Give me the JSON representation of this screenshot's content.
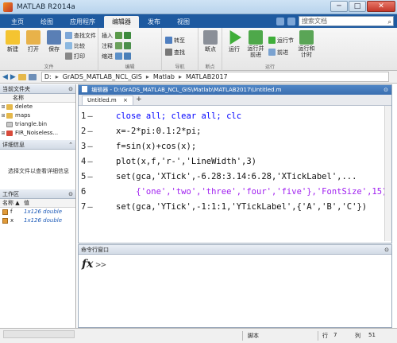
{
  "window": {
    "title": "MATLAB R2014a",
    "minimize": "─",
    "maximize": "□",
    "close": "✕"
  },
  "tabs": [
    "主页",
    "绘图",
    "应用程序",
    "编辑器",
    "发布",
    "视图"
  ],
  "search": {
    "placeholder": "搜索文档",
    "icon": "search-icon"
  },
  "ribbon": {
    "new_label": "新建",
    "open_label": "打开",
    "save_label": "保存",
    "find_files": "查找文件",
    "compare": "比较",
    "print": "打印",
    "insert": "插入",
    "comment": "注释",
    "indent": "缩进",
    "goto": "转至",
    "find": "查找",
    "breakpoints": "断点",
    "run": "运行",
    "run_advance": "运行并\n前进",
    "run_section": "运行节",
    "advance": "前进",
    "run_time": "运行和\n计时",
    "group_file": "文件",
    "group_edit": "编辑",
    "group_nav": "导航",
    "group_bp": "断点",
    "group_run": "运行"
  },
  "address": {
    "crumbs": [
      "D:",
      "GrADS_MATLAB_NCL_GIS",
      "Matlab",
      "MATLAB2017"
    ]
  },
  "current_folder": {
    "title": "当前文件夹",
    "name_header": "名称",
    "items": [
      {
        "name": "delete",
        "type": "folder"
      },
      {
        "name": "maps",
        "type": "folder"
      },
      {
        "name": "triangle.bin",
        "type": "file"
      },
      {
        "name": "FIR_Noiseless...",
        "type": "file"
      }
    ]
  },
  "details": {
    "title": "详细信息",
    "message": "选择文件以查看详细信息"
  },
  "workspace": {
    "title": "工作区",
    "headers": [
      "名称 ▲",
      "值"
    ],
    "vars": [
      {
        "name": "f",
        "value": "1x126 double"
      },
      {
        "name": "x",
        "value": "1x126 double"
      }
    ]
  },
  "editor": {
    "title": "编辑器 - D:\\GrADS_MATLAB_NCL_GIS\\Matlab\\MATLAB2017\\Untitled.m",
    "tab": "Untitled.m",
    "add_tab": "+",
    "lines": [
      {
        "num": "1",
        "dash": "—",
        "code": "close all; clear all; clc"
      },
      {
        "num": "2",
        "dash": "—",
        "code": "x=-2*pi:0.1:2*pi;"
      },
      {
        "num": "3",
        "dash": "—",
        "code": "f=sin(x)+cos(x);"
      },
      {
        "num": "4",
        "dash": "—",
        "code": "plot(x,f,'r-','LineWidth',3)"
      },
      {
        "num": "5",
        "dash": "—",
        "code": "set(gca,'XTick',-6.28:3.14:6.28,'XTickLabel',..."
      },
      {
        "num": "6",
        "dash": "",
        "code": "    {'one','two','three','four','five'},'FontSize',15)"
      },
      {
        "num": "7",
        "dash": "—",
        "code": "set(gca,'YTick',-1:1:1,'YTickLabel',{'A','B','C'})"
      }
    ]
  },
  "command_window": {
    "title": "命令行窗口",
    "fx": "fx",
    "prompt": ">>"
  },
  "status": {
    "script": "脚本",
    "row_label": "行",
    "row": "7",
    "col_label": "列",
    "col": "51"
  },
  "colors": {
    "tab_bar": "#1e5aa0",
    "string": "#a020f0",
    "keyword": "#0000ff"
  }
}
